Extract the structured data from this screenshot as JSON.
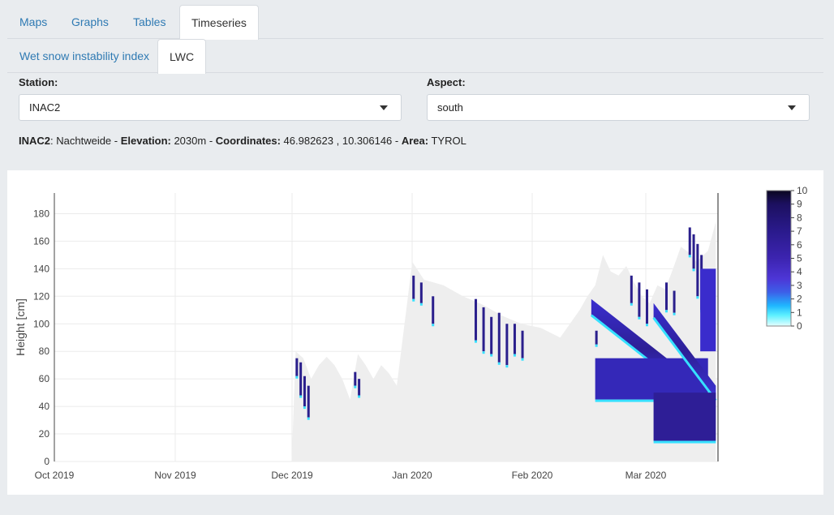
{
  "tabs_main": [
    "Maps",
    "Graphs",
    "Tables",
    "Timeseries"
  ],
  "tabs_sub": [
    "Wet snow instability index",
    "LWC"
  ],
  "station": {
    "label": "Station:",
    "value": "INAC2"
  },
  "aspect": {
    "label": "Aspect:",
    "value": "south"
  },
  "info": {
    "station_id": "INAC2",
    "station_name": ": Nachtweide - ",
    "elev_label": "Elevation:",
    "elev_value": " 2030m - ",
    "coord_label": "Coordinates:",
    "coord_value": " 46.982623 , 10.306146 - ",
    "area_label": "Area:",
    "area_value": " TYROL"
  },
  "colors": {
    "accent": "#2f7ab3",
    "snow": "#eeeeee",
    "lwc_dark": "#2a1f8c",
    "lwc_light": "#36e0ff"
  },
  "chart_data": {
    "type": "heatmap",
    "ylabel": "Height [cm]",
    "x_ticks": [
      "Oct 2019",
      "Nov 2019",
      "Dec 2019",
      "Jan 2020",
      "Feb 2020",
      "Mar 2020"
    ],
    "y_ticks": [
      0,
      20,
      40,
      60,
      80,
      100,
      120,
      140,
      160,
      180
    ],
    "ylim": [
      0,
      195
    ],
    "colorbar": {
      "min": 0,
      "max": 10,
      "ticks": [
        0,
        1,
        2,
        3,
        4,
        5,
        6,
        7,
        8,
        9,
        10
      ]
    },
    "snow_height": [
      [
        61,
        0
      ],
      [
        62,
        80
      ],
      [
        64,
        75
      ],
      [
        66,
        60
      ],
      [
        68,
        70
      ],
      [
        70,
        76
      ],
      [
        72,
        70
      ],
      [
        74,
        60
      ],
      [
        76,
        45
      ],
      [
        78,
        78
      ],
      [
        80,
        70
      ],
      [
        82,
        60
      ],
      [
        84,
        70
      ],
      [
        86,
        64
      ],
      [
        88,
        55
      ],
      [
        90,
        100
      ],
      [
        92,
        145
      ],
      [
        95,
        132
      ],
      [
        100,
        128
      ],
      [
        105,
        120
      ],
      [
        110,
        114
      ],
      [
        115,
        106
      ],
      [
        120,
        100
      ],
      [
        125,
        97
      ],
      [
        130,
        90
      ],
      [
        135,
        110
      ],
      [
        137,
        120
      ],
      [
        139,
        128
      ],
      [
        141,
        150
      ],
      [
        143,
        138
      ],
      [
        145,
        135
      ],
      [
        147,
        142
      ],
      [
        149,
        130
      ],
      [
        151,
        120
      ],
      [
        153,
        115
      ],
      [
        155,
        128
      ],
      [
        157,
        125
      ],
      [
        159,
        140
      ],
      [
        161,
        156
      ],
      [
        163,
        152
      ],
      [
        165,
        145
      ],
      [
        168,
        153
      ],
      [
        170,
        174
      ]
    ],
    "snow_height_end": 170
  }
}
